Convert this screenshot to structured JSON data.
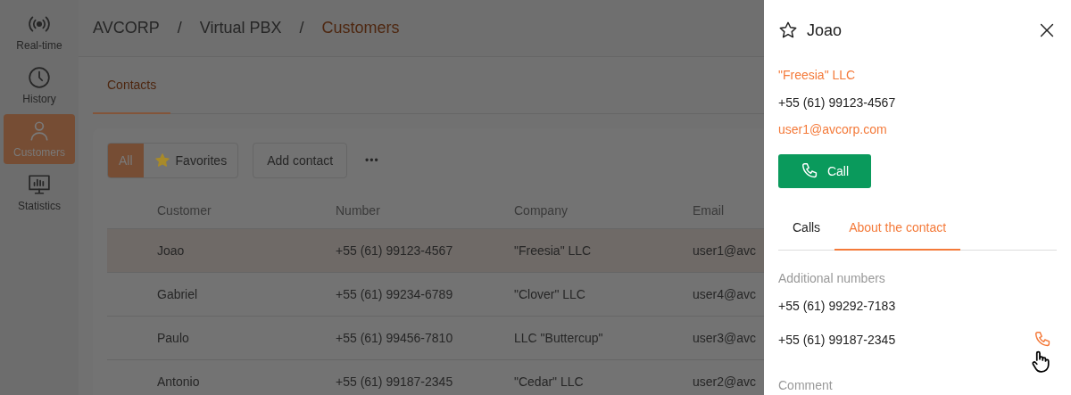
{
  "sidebar": {
    "items": [
      {
        "label": "Real-time",
        "selected": false
      },
      {
        "label": "History",
        "selected": false
      },
      {
        "label": "Customers",
        "selected": true
      },
      {
        "label": "Statistics",
        "selected": false
      }
    ]
  },
  "breadcrumb": [
    {
      "label": "AVCORP",
      "current": false
    },
    {
      "label": "Virtual PBX",
      "current": false
    },
    {
      "label": "Customers",
      "current": true
    }
  ],
  "breadcrumb_separator": "/",
  "tabs": [
    {
      "label": "Contacts",
      "selected": true
    }
  ],
  "toolbar": {
    "filters": [
      {
        "label": "All",
        "selected": true,
        "kind": "plain"
      },
      {
        "label": "Favorites",
        "selected": false,
        "kind": "starred"
      }
    ],
    "add_button": "Add contact",
    "more_button": "•••"
  },
  "table": {
    "columns": [
      "Customer",
      "Number",
      "Company",
      "Email"
    ],
    "rows": [
      {
        "cells": [
          "Joao",
          "+55 (61) 99123-4567",
          "\"Freesia\" LLC",
          "user1@avc"
        ],
        "selected": true
      },
      {
        "cells": [
          "Gabriel",
          "+55 (61) 99234-6789",
          "\"Clover\" LLC",
          "user4@avc"
        ],
        "selected": false
      },
      {
        "cells": [
          "Paulo",
          "+55 (61) 99456-7810",
          "LLC \"Buttercup\"",
          "user3@avc"
        ],
        "selected": false
      },
      {
        "cells": [
          "Antonio",
          "+55 (61) 99187-2345",
          "\"Cedar\" LLC",
          "user2@avc"
        ],
        "selected": false
      }
    ]
  },
  "panel": {
    "name": "Joao",
    "favorite": false,
    "company": "\"Freesia\" LLC",
    "phone": "+55 (61) 99123-4567",
    "email": "user1@avcorp.com",
    "call_button": "Call",
    "tabs": [
      {
        "label": "Calls",
        "selected": false
      },
      {
        "label": "About the contact",
        "selected": true
      }
    ],
    "additional_numbers_label": "Additional numbers",
    "additional_numbers": [
      {
        "number": "+55 (61) 99292-7183",
        "hovered": false
      },
      {
        "number": "+55 (61) 99187-2345",
        "hovered": true
      }
    ],
    "comment_label": "Comment"
  }
}
